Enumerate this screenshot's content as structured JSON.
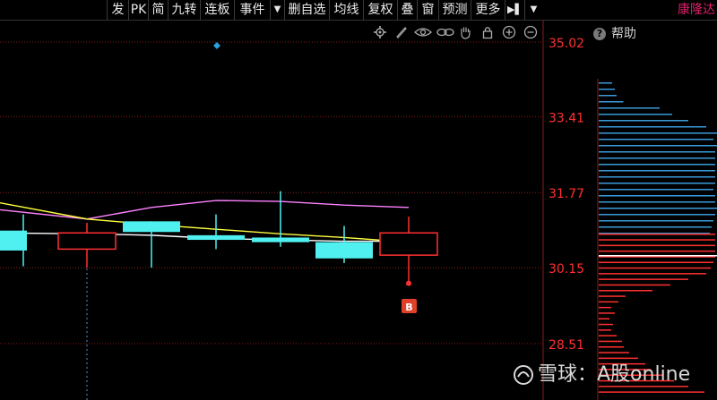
{
  "toolbar": {
    "items": [
      {
        "label": "发"
      },
      {
        "label": "PK"
      },
      {
        "label": "简"
      },
      {
        "label": "九转"
      },
      {
        "label": "连板"
      },
      {
        "label": "事件"
      },
      {
        "label": "▼"
      },
      {
        "label": "删自选"
      },
      {
        "label": "均线"
      },
      {
        "label": "复权"
      },
      {
        "label": "叠"
      },
      {
        "label": "窗"
      },
      {
        "label": "预测"
      },
      {
        "label": "更多"
      },
      {
        "label": "▶▌"
      },
      {
        "label": "▼"
      }
    ]
  },
  "stock_name": "康隆达",
  "help_label": "帮助",
  "help_icon_glyph": "?",
  "marker_label": "B",
  "watermark_text": "雪球：A股online",
  "colors": {
    "up": "#ff3030",
    "down": "#50f0f0",
    "price_axis": "#ff3030",
    "ma_white": "#ffffff",
    "ma_yellow": "#ffff40",
    "ma_pink": "#ff80ff",
    "grid": "#8a1c1c",
    "vol_blue": "#3a9ad8",
    "vol_red": "#ff3030"
  },
  "chart_data": {
    "type": "candlestick",
    "y_axis_ticks": [
      "35.02",
      "33.41",
      "31.77",
      "30.15",
      "28.51"
    ],
    "ylim": [
      28.51,
      35.02
    ],
    "candles": [
      {
        "open": 30.95,
        "close": 30.52,
        "high": 31.3,
        "low": 30.18,
        "dir": "down"
      },
      {
        "open": 30.55,
        "close": 30.9,
        "high": 31.12,
        "low": 30.15,
        "dir": "up"
      },
      {
        "open": 31.15,
        "close": 30.92,
        "high": 31.15,
        "low": 30.15,
        "dir": "down"
      },
      {
        "open": 30.85,
        "close": 30.75,
        "high": 31.3,
        "low": 30.55,
        "dir": "down"
      },
      {
        "open": 30.8,
        "close": 30.7,
        "high": 31.8,
        "low": 30.6,
        "dir": "down"
      },
      {
        "open": 30.7,
        "close": 30.35,
        "high": 31.05,
        "low": 30.25,
        "dir": "down"
      },
      {
        "open": 30.42,
        "close": 30.9,
        "high": 31.25,
        "low": 29.85,
        "dir": "up"
      }
    ],
    "ma_white": [
      30.9,
      30.88,
      30.85,
      30.78,
      30.75,
      30.72,
      30.72
    ],
    "ma_yellow": [
      31.55,
      31.2,
      31.08,
      30.98,
      30.88,
      30.8,
      30.7
    ],
    "ma_pink": [
      31.4,
      31.2,
      31.45,
      31.6,
      31.58,
      31.5,
      31.45
    ],
    "buy_marker": {
      "candle_index": 6,
      "price": 29.85
    }
  }
}
